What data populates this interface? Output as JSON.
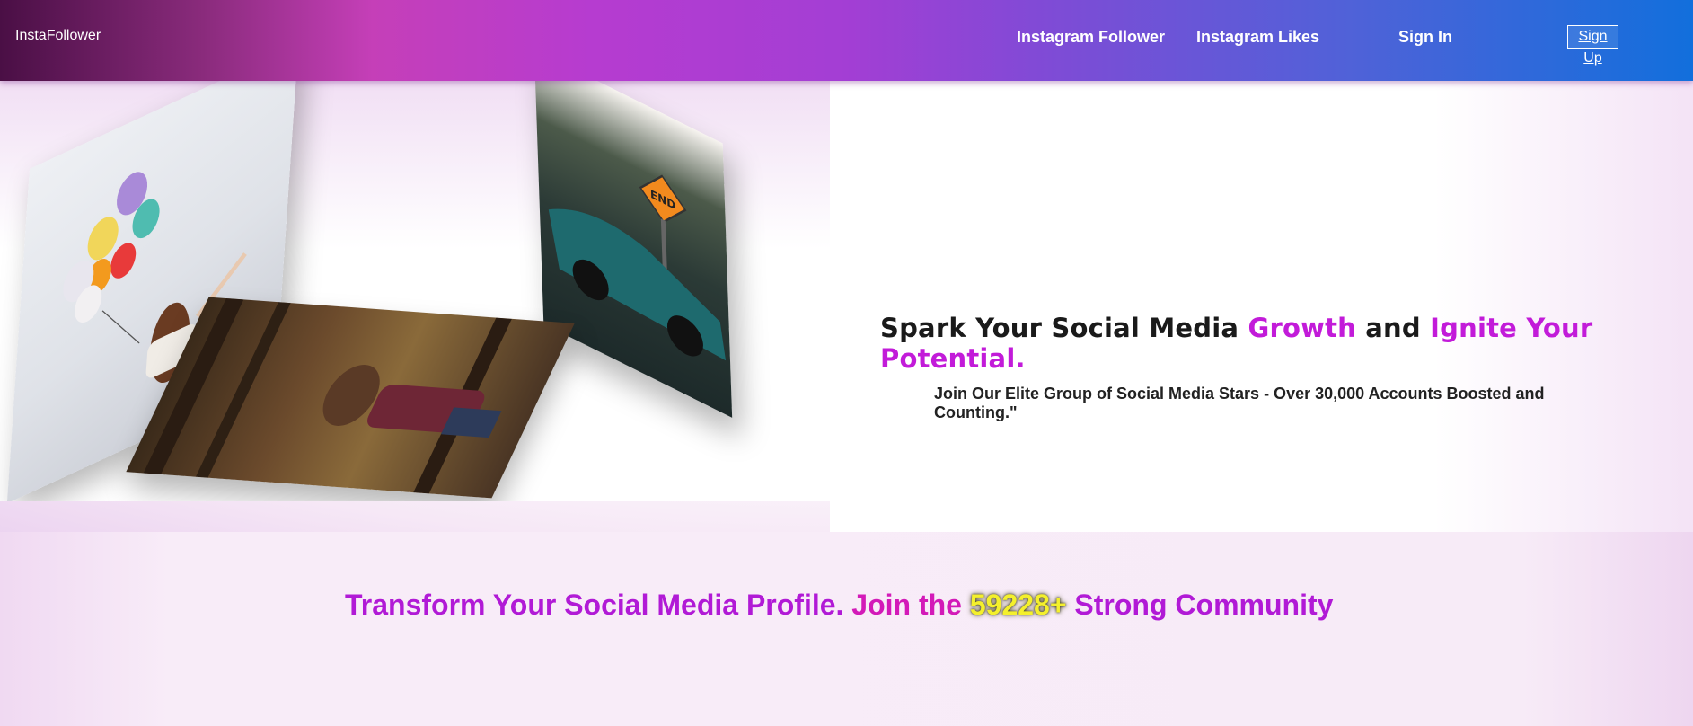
{
  "header": {
    "brand": "InstaFollower",
    "nav": {
      "follower": "Instagram Follower",
      "likes": "Instagram Likes",
      "signin": "Sign In",
      "signup": "Sign Up"
    }
  },
  "hero": {
    "headline": {
      "part1": "Spark Your Social Media ",
      "growth": "Growth",
      "part2": " and ",
      "ignite": "Ignite Your Potential."
    },
    "subline": "Join Our Elite Group of Social Media Stars - Over 30,000 Accounts Boosted and Counting.\""
  },
  "community": {
    "part1": "Transform Your Social Media Profile. ",
    "part2": "Join the ",
    "count": "59228+",
    "part3": " Strong Community"
  },
  "colors": {
    "accent": "#c21bd9",
    "header_start": "#4a0f45",
    "header_end": "#126fdc"
  }
}
